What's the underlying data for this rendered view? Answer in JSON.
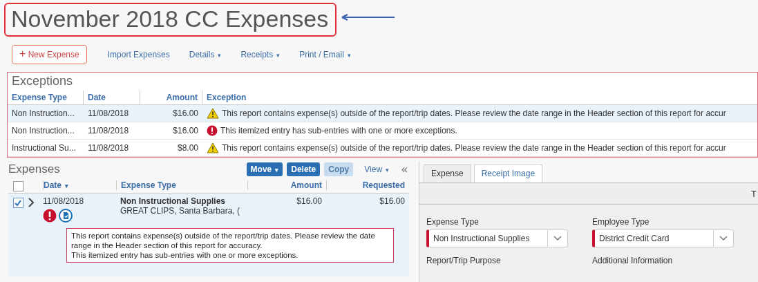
{
  "title": "November 2018 CC Expenses",
  "toolbar": {
    "new_button": {
      "icon": "+",
      "label": "New Expense"
    },
    "items": [
      {
        "label": "Import Expenses"
      },
      {
        "label": "Details",
        "caret": "▾"
      },
      {
        "label": "Receipts",
        "caret": "▾"
      },
      {
        "label": "Print / Email",
        "caret": "▾"
      }
    ]
  },
  "exceptions": {
    "title": "Exceptions",
    "columns": [
      "Expense Type",
      "Date",
      "Amount",
      "Exception"
    ],
    "rows": [
      {
        "expense_type": "Non Instruction...",
        "date": "11/08/2018",
        "amount": "$16.00",
        "kind": "warning",
        "exception": "This report contains expense(s) outside of the report/trip dates. Please review the date range in the Header section of this report for accur",
        "selected": true
      },
      {
        "expense_type": "Non Instruction...",
        "date": "11/08/2018",
        "amount": "$16.00",
        "kind": "error",
        "exception": "This itemized entry has sub-entries with one or more exceptions.",
        "selected": false
      },
      {
        "expense_type": "Instructional Su...",
        "date": "11/08/2018",
        "amount": "$8.00",
        "kind": "warning",
        "exception": "This report contains expense(s) outside of the report/trip dates. Please review the date range in the Header section of this report for accur",
        "selected": false
      }
    ]
  },
  "expenses": {
    "title": "Expenses",
    "buttons": [
      {
        "label": "Move",
        "caret": "▾",
        "disabled": false
      },
      {
        "label": "Delete",
        "disabled": false
      },
      {
        "label": "Copy",
        "disabled": true
      }
    ],
    "view": {
      "label": "View",
      "caret": "▾"
    },
    "collapse": "«",
    "all_checked": false,
    "columns": [
      {
        "label": "Date",
        "caret": "▾"
      },
      {
        "label": "Expense Type"
      },
      {
        "label": "Amount"
      },
      {
        "label": "Requested"
      }
    ],
    "rows": [
      {
        "checked": true,
        "date": "11/08/2018",
        "expense_type": "Non Instructional Supplies",
        "merchant": "GREAT CLIPS, Santa Barbara, (",
        "amount": "$16.00",
        "requested": "$16.00",
        "messages": [
          "This report contains expense(s) outside of the report/trip dates. Please review the date range in the Header section of this report for accuracy.",
          "This itemized entry has sub-entries with one or more exceptions."
        ]
      }
    ]
  },
  "detail": {
    "tabs": [
      {
        "label": "Expense",
        "selected": true
      },
      {
        "label": "Receipt Image",
        "selected": false
      }
    ],
    "header_text": "T",
    "fields": [
      {
        "label": "Expense Type",
        "value": "Non Instructional Supplies",
        "required": true
      },
      {
        "label": "Employee Type",
        "value": "District Credit Card",
        "required": true
      },
      {
        "label": "Report/Trip Purpose"
      },
      {
        "label": "Additional Information"
      }
    ]
  }
}
